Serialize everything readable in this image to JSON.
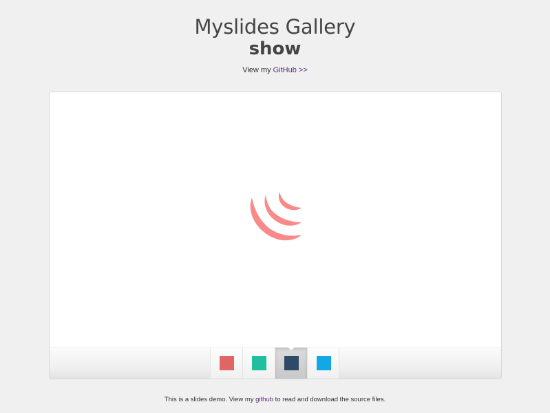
{
  "header": {
    "title_line1": "Myslides Gallery",
    "title_line2": "show",
    "subtitle_prefix": "View my ",
    "subtitle_link": "GitHub",
    "subtitle_suffix": " >>"
  },
  "slide": {
    "logo_icon": "jquery-logo-icon",
    "logo_color": "#f88a8a"
  },
  "thumbnails": [
    {
      "color": "#e06666",
      "name": "red"
    },
    {
      "color": "#1fbfa0",
      "name": "teal"
    },
    {
      "color": "#2e4a66",
      "name": "navy"
    },
    {
      "color": "#12a8e6",
      "name": "blue"
    }
  ],
  "active_thumbnail": 2,
  "footer": {
    "prefix": "This is a slides demo. View my ",
    "link": "github",
    "suffix": " to read and download the source files."
  }
}
